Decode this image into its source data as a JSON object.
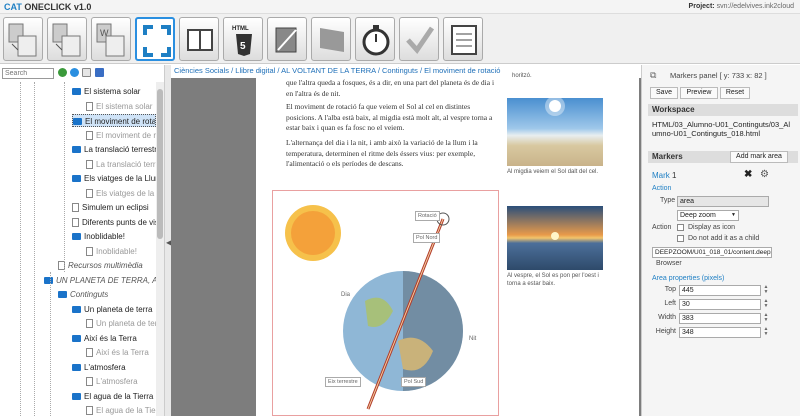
{
  "app": {
    "title_prefix": "CAT",
    "title_rest": " ONECLICK v1.0",
    "project_label": "Project:",
    "project_value": "svn://edelvives.ink2cloud"
  },
  "toolbar": {
    "buttons": [
      "pdf-to-html-tool",
      "html-to-html-tool",
      "word-to-html-tool",
      "markers-tool",
      "book-tool",
      "html5-editor-tool",
      "slash-tool",
      "flag-tool",
      "timer-tool",
      "check-tool",
      "document-tool"
    ]
  },
  "left": {
    "search_placeholder": "Search",
    "tree": [
      {
        "label": "El sistema solar",
        "kind": "folder"
      },
      {
        "label": "El sistema solar",
        "kind": "doc-grey"
      },
      {
        "label": "El moviment de rotació",
        "kind": "folder-sel"
      },
      {
        "label": "El moviment de rotació",
        "kind": "doc-grey"
      },
      {
        "label": "La translació terrestre",
        "kind": "folder"
      },
      {
        "label": "La translació terrestre",
        "kind": "doc-grey"
      },
      {
        "label": "Els viatges de la Llum",
        "kind": "folder"
      },
      {
        "label": "Els viatges de la Llum",
        "kind": "doc-grey"
      },
      {
        "label": "Simulem un eclipsi",
        "kind": "doc"
      },
      {
        "label": "Diferents punts de vista",
        "kind": "doc"
      },
      {
        "label": "Inoblidable!",
        "kind": "folder"
      },
      {
        "label": "Inoblidable!",
        "kind": "doc-grey"
      },
      {
        "label": "Recursos multimèdia",
        "kind": "italic-doc"
      },
      {
        "label": "UN PLANETA DE TERRA, AIRE I AIGUA",
        "kind": "folder-root"
      },
      {
        "label": "Continguts",
        "kind": "italic-folder"
      },
      {
        "label": "Un planeta de terra",
        "kind": "folder"
      },
      {
        "label": "Un planeta de terra",
        "kind": "doc-grey"
      },
      {
        "label": "Així és la Terra",
        "kind": "folder"
      },
      {
        "label": "Així és la Terra",
        "kind": "doc-grey"
      },
      {
        "label": "L'atmosfera",
        "kind": "folder"
      },
      {
        "label": "L'atmosfera",
        "kind": "doc-grey"
      },
      {
        "label": "El agua de la Tierra",
        "kind": "folder"
      },
      {
        "label": "El agua de la Tierra",
        "kind": "doc-grey"
      }
    ]
  },
  "breadcrumb": "Ciències Socials / Llibre digital / AL VOLTANT DE LA TERRA / Continguts / El moviment de rotació",
  "page": {
    "p0": "que l'altra queda a fosques, és a dir, en una part del planeta és de dia i en l'altra és de nit.",
    "p1": "El moviment de rotació fa que veiem el Sol al cel en distintes posicions. A l'alba està baix, al migdia està molt alt, al vespre torna a estar baix i quan es fa fosc no el veiem.",
    "p2": "L'alternança del dia i la nit, i amb això la variació de la llum i la temperatura, determinen el ritme dels éssers vius: per exemple, l'alimentació o els períodes de descans.",
    "cap_top": "horitzó.",
    "cap1": "Al migdia veiem el Sol dalt del cel.",
    "cap2": "Al vespre, el Sol es pon per l'oest i torna a estar baix.",
    "ill": {
      "rotacio": "Rotació",
      "pol_nord": "Pol Nord",
      "dia": "Dia",
      "nit": "Nit",
      "eix": "Eix terrestre",
      "pol_sud": "Pol Sud"
    }
  },
  "right": {
    "panel_title": "Markers panel",
    "coords": "[ y: 733 x: 82 ]",
    "tab_save": "Save",
    "tab_preview": "Preview",
    "tab_reset": "Reset",
    "workspace_title": "Workspace",
    "workspace_path": "HTML/03_Alumno-U01_Continguts/03_Alumno-U01_Continguts_018.html",
    "markers_title": "Markers",
    "add_mark": "Add mark area",
    "mark_label": "Mark",
    "mark_num": "1",
    "action_title": "Action",
    "type_label": "Type",
    "type_value": "area",
    "zoom_value": "Deep zoom",
    "action_label": "Action",
    "display_icon": "Display as icon",
    "not_child": "Do not add it as a child",
    "deepzoom_path": "DEEPZOOM/U01_018_01/content.deepz",
    "browser": "Browser",
    "area_title": "Area properties (pixels)",
    "props": [
      {
        "label": "Top",
        "value": "445"
      },
      {
        "label": "Left",
        "value": "30"
      },
      {
        "label": "Width",
        "value": "383"
      },
      {
        "label": "Height",
        "value": "348"
      }
    ],
    "colors": {
      "accent": "#1e7fc4",
      "folder": "#1a73c9",
      "marker_border": "#e9a0a0"
    }
  }
}
